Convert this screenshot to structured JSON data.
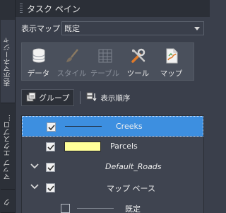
{
  "side_tabs": [
    {
      "label": "表示マネージャ"
    },
    {
      "label": "マップ エクスプロ..."
    },
    {
      "label": "ク"
    }
  ],
  "panel": {
    "title": "タスク ペイン",
    "display_map_label": "表示マップ",
    "display_map_value": "既定"
  },
  "toolbar": {
    "items": [
      {
        "label": "データ",
        "icon": "database-icon",
        "enabled": true
      },
      {
        "label": "スタイル",
        "icon": "brush-icon",
        "enabled": false
      },
      {
        "label": "テーブル",
        "icon": "table-icon",
        "enabled": false
      },
      {
        "label": "ツール",
        "icon": "tools-icon",
        "enabled": true
      },
      {
        "label": "マップ",
        "icon": "map-icon",
        "enabled": true
      }
    ]
  },
  "subbar": {
    "group_label": "グループ",
    "order_label": "表示順序"
  },
  "layers": [
    {
      "name": "Creeks",
      "checked": true,
      "selected": true,
      "symbol": "line"
    },
    {
      "name": "Parcels",
      "checked": true,
      "selected": false,
      "symbol": "fill",
      "fill_color": "#ffff99"
    },
    {
      "name": "Default_Roads",
      "checked": true,
      "selected": false,
      "expandable": true
    },
    {
      "name": "マップ ベース",
      "checked": true,
      "selected": false,
      "expandable": true
    },
    {
      "name": "既定",
      "checked": false,
      "selected": false,
      "symbol": "line-grey"
    }
  ],
  "colors": {
    "accent": "#3d8fe0",
    "panel_bg": "#3a3f4b",
    "parcel_fill": "#ffff99"
  }
}
